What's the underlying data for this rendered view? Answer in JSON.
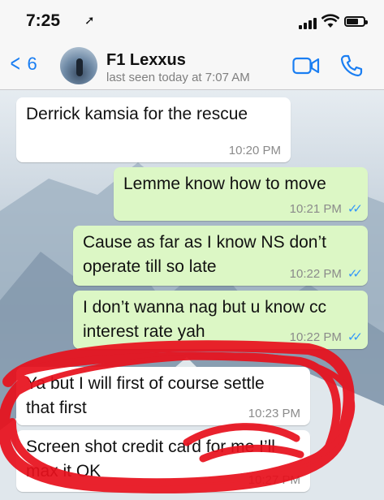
{
  "status_bar": {
    "time": "7:25",
    "location_icon": "location-arrow-icon",
    "battery_level": 0.8
  },
  "header": {
    "back_count": "6",
    "contact_name": "F1 Lexxus",
    "last_seen": "last seen today at 7:07 AM",
    "icons": [
      "back-chevron-icon",
      "video-call-icon",
      "phone-call-icon"
    ],
    "accent_color": "#1a7ef2"
  },
  "messages": [
    {
      "direction": "in",
      "text": "Derrick kamsia for the rescue",
      "time": "10:20 PM"
    },
    {
      "direction": "out",
      "text": "Lemme know how to move",
      "time": "10:21 PM",
      "read": true
    },
    {
      "direction": "out",
      "text": "Cause as far as I know NS don’t operate till so late",
      "time": "10:22 PM",
      "read": true
    },
    {
      "direction": "out",
      "text": "I don’t wanna nag but u know cc interest rate yah",
      "time": "10:22 PM",
      "read": true
    },
    {
      "direction": "in",
      "text": "Ya but I will first of course settle that first",
      "time": "10:23 PM"
    },
    {
      "direction": "in",
      "text": "Screen shot credit card for me I’ll max it OK",
      "time": "10:27 PM"
    }
  ],
  "colors": {
    "incoming_bubble": "#ffffff",
    "outgoing_bubble": "#dcf7c5",
    "read_ticks": "#3497f9",
    "scribble": "#e8101c"
  }
}
